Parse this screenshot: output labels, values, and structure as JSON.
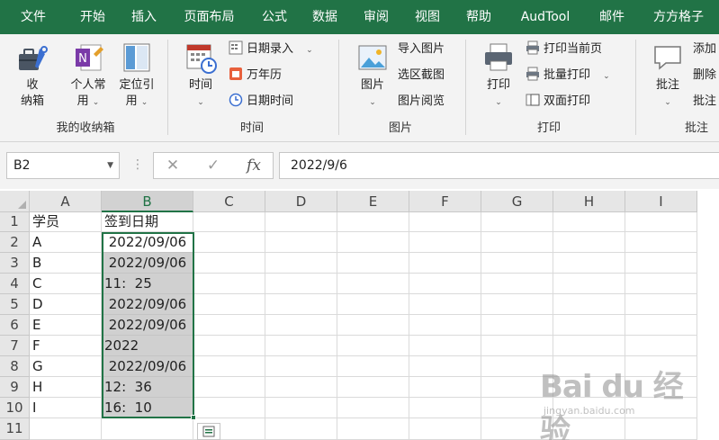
{
  "ribbon_tabs": [
    {
      "id": "file",
      "label": "文件"
    },
    {
      "id": "home",
      "label": "开始"
    },
    {
      "id": "insert",
      "label": "插入"
    },
    {
      "id": "layout",
      "label": "页面布局"
    },
    {
      "id": "formula",
      "label": "公式"
    },
    {
      "id": "data",
      "label": "数据"
    },
    {
      "id": "review",
      "label": "审阅"
    },
    {
      "id": "view",
      "label": "视图"
    },
    {
      "id": "help",
      "label": "帮助"
    },
    {
      "id": "audtool",
      "label": "AudTool"
    },
    {
      "id": "mail",
      "label": "邮件"
    },
    {
      "id": "ffgz",
      "label": "方方格子"
    }
  ],
  "ribbon": {
    "groups": {
      "mybox": "我的收纳箱",
      "time": "时间",
      "picture": "图片",
      "print": "打印",
      "comment": "批注"
    },
    "buttons": {
      "storage_l1": "收",
      "storage_l2": "纳箱",
      "personal_l1": "个人常",
      "personal_l2": "用",
      "locate_l1": "定位引",
      "locate_l2": "用",
      "time_big": "时间",
      "date_entry": "日期录入",
      "calendar": "万年历",
      "datetime": "日期时间",
      "picture_big": "图片",
      "import_pic": "导入图片",
      "area_capture": "选区截图",
      "pic_browse": "图片阅览",
      "print_big": "打印",
      "print_current": "打印当前页",
      "batch_print": "批量打印",
      "duplex_print": "双面打印",
      "comment_big": "批注",
      "add": "添加",
      "delete": "删除",
      "comment_small": "批注"
    }
  },
  "formula_bar": {
    "name_box": "B2",
    "cancel_icon": "✕",
    "enter_icon": "✓",
    "fx_label": "fx",
    "value": "2022/9/6"
  },
  "sheet": {
    "columns": [
      "A",
      "B",
      "C",
      "D",
      "E",
      "F",
      "G",
      "H",
      "I"
    ],
    "rows": [
      "1",
      "2",
      "3",
      "4",
      "5",
      "6",
      "7",
      "8",
      "9",
      "10",
      "11"
    ],
    "colA": [
      "学员",
      "A",
      "B",
      "C",
      "D",
      "E",
      "F",
      "G",
      "H",
      "I",
      ""
    ],
    "colB": [
      "签到日期",
      " 2022/09/06",
      " 2022/09/06",
      "11:  25",
      " 2022/09/06",
      " 2022/09/06",
      "2022",
      " 2022/09/06",
      "12:  36",
      "16:  10",
      ""
    ],
    "selected_column": "B",
    "active_cell": "B2"
  },
  "watermark": {
    "logo": "Bai du 经验",
    "url": "jingyan.baidu.com"
  },
  "colors": {
    "accent": "#217346",
    "selection_fill": "#d0d0d0",
    "ribbon_bg": "#f3f3f3"
  }
}
